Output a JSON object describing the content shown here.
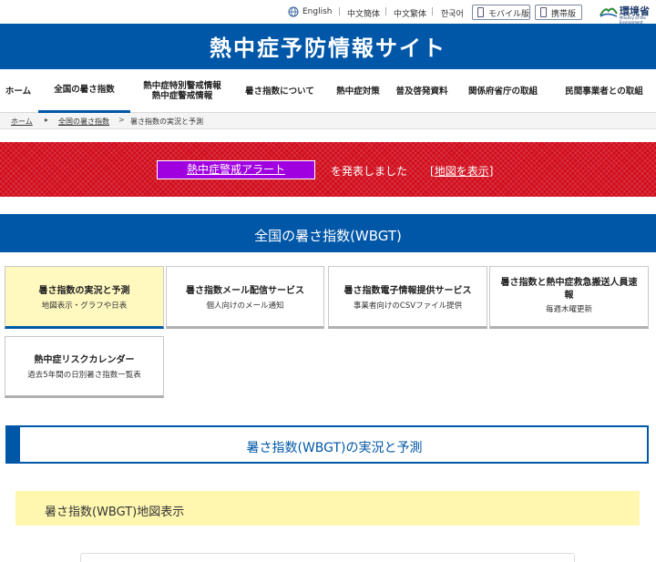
{
  "util": {
    "english": "English",
    "simplified": "中文簡体",
    "traditional": "中文繁体",
    "korean": "한국어",
    "mobile": "モバイル版",
    "feature_phone": "携帯版",
    "ministry": "環境省",
    "ministry_en": "Ministry of the Environment"
  },
  "site_title": "熱中症予防情報サイト",
  "nav": [
    {
      "label": "ホーム"
    },
    {
      "label": "全国の暑さ指数"
    },
    {
      "label": "熱中症特別警戒情報",
      "label2": "熱中症警戒情報"
    },
    {
      "label": "暑さ指数について"
    },
    {
      "label": "熱中症対策"
    },
    {
      "label": "普及啓発資料"
    },
    {
      "label": "関係府省庁の取組"
    },
    {
      "label": "民間事業者との取組"
    }
  ],
  "breadcrumb": {
    "home": "ホーム",
    "level1": "全国の暑さ指数",
    "current": "暑さ指数の実況と予測"
  },
  "alert": {
    "badge": "熱中症警戒アラート",
    "text": "を発表しました",
    "map_open": "[",
    "map_link": "地図を表示",
    "map_close": "]"
  },
  "section_title": "全国の暑さ指数(WBGT)",
  "cards": [
    {
      "title": "暑さ指数の実況と予測",
      "sub": "地図表示・グラフや日表"
    },
    {
      "title": "暑さ指数メール配信サービス",
      "sub": "個人向けのメール通知"
    },
    {
      "title": "暑さ指数電子情報提供サービス",
      "sub": "事業者向けのCSVファイル提供"
    },
    {
      "title": "暑さ指数と熱中症救急搬送人員速報",
      "sub": "毎週木曜更新"
    },
    {
      "title": "熱中症リスクカレンダー",
      "sub": "過去5年間の日別暑さ指数一覧表"
    }
  ],
  "subhead_title": "暑さ指数(WBGT)の実況と予測",
  "map_heading": "暑さ指数(WBGT)地図表示",
  "colors": {
    "brand_blue": "#0057a8",
    "alert_red": "#d10d1d",
    "alert_purple": "#a000e0",
    "active_yellow": "#fff9c0"
  }
}
